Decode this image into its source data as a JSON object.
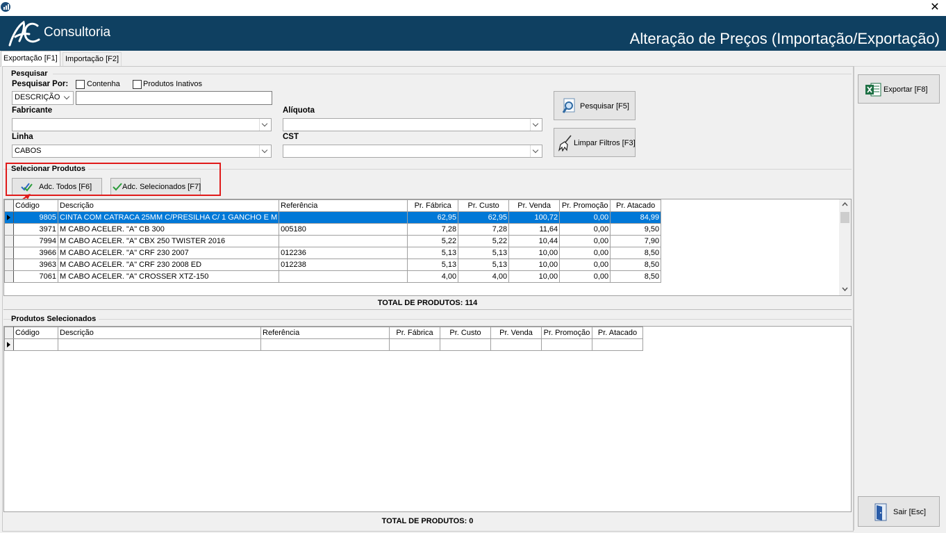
{
  "window": {
    "close_glyph": "✕"
  },
  "header": {
    "brand": "Consultoria",
    "logo_text": "AC",
    "title": "Alteração de Preços (Importação/Exportação)"
  },
  "tabs": [
    {
      "label": "Exportação [F1]",
      "active": true
    },
    {
      "label": "Importação [F2]",
      "active": false
    }
  ],
  "search": {
    "group_title": "Pesquisar",
    "search_by_label": "Pesquisar Por:",
    "contains_label": "Contenha",
    "inactive_label": "Produtos Inativos",
    "search_field": "DESCRIÇÃO",
    "search_value": "",
    "manufacturer_label": "Fabricante",
    "manufacturer_value": "",
    "line_label": "Linha",
    "line_value": "CABOS",
    "rate_label": "Alíquota",
    "rate_value": "",
    "cst_label": "CST",
    "cst_value": "",
    "search_button": "Pesquisar [F5]",
    "clear_button": "Limpar Filtros [F3]"
  },
  "select": {
    "group_title": "Selecionar Produtos",
    "add_all_button": "Adc. Todos [F6]",
    "add_selected_button": "Adc. Selecionados [F7]"
  },
  "columns": [
    "Código",
    "Descrição",
    "Referência",
    "Pr. Fábrica",
    "Pr. Custo",
    "Pr. Venda",
    "Pr. Promoção",
    "Pr. Atacado"
  ],
  "products": [
    {
      "codigo": "9805",
      "descricao": "CINTA COM CATRACA 25MM C/PRESILHA C/ 1 GANCHO E M",
      "referencia": "",
      "fabrica": "62,95",
      "custo": "62,95",
      "venda": "100,72",
      "promocao": "0,00",
      "atacado": "84,99",
      "selected": true
    },
    {
      "codigo": "3971",
      "descricao": "M CABO ACELER. \"A\" CB 300",
      "referencia": "005180",
      "fabrica": "7,28",
      "custo": "7,28",
      "venda": "11,64",
      "promocao": "0,00",
      "atacado": "9,50"
    },
    {
      "codigo": "7994",
      "descricao": "M CABO ACELER. \"A\" CBX 250 TWISTER 2016",
      "referencia": "",
      "fabrica": "5,22",
      "custo": "5,22",
      "venda": "10,44",
      "promocao": "0,00",
      "atacado": "7,90"
    },
    {
      "codigo": "3966",
      "descricao": "M CABO ACELER. \"A\" CRF 230 2007",
      "referencia": "012236",
      "fabrica": "5,13",
      "custo": "5,13",
      "venda": "10,00",
      "promocao": "0,00",
      "atacado": "8,50"
    },
    {
      "codigo": "3963",
      "descricao": "M CABO ACELER. \"A\" CRF 230 2008 ED",
      "referencia": "012238",
      "fabrica": "5,13",
      "custo": "5,13",
      "venda": "10,00",
      "promocao": "0,00",
      "atacado": "8,50"
    },
    {
      "codigo": "7061",
      "descricao": "M CABO ACELER. \"A\" CROSSER XTZ-150",
      "referencia": "",
      "fabrica": "4,00",
      "custo": "4,00",
      "venda": "10,00",
      "promocao": "0,00",
      "atacado": "8,50"
    }
  ],
  "products_total": "TOTAL DE PRODUTOS: 114",
  "selected_group_title": "Produtos Selecionados",
  "selected_total": "TOTAL DE PRODUTOS: 0",
  "side": {
    "export_button": "Exportar [F8]",
    "exit_button": "Sair [Esc]"
  },
  "colors": {
    "header_bg": "#0f4061",
    "selection": "#0078d7",
    "highlight_box": "#e01a1a",
    "excel_green": "#1d7044"
  }
}
